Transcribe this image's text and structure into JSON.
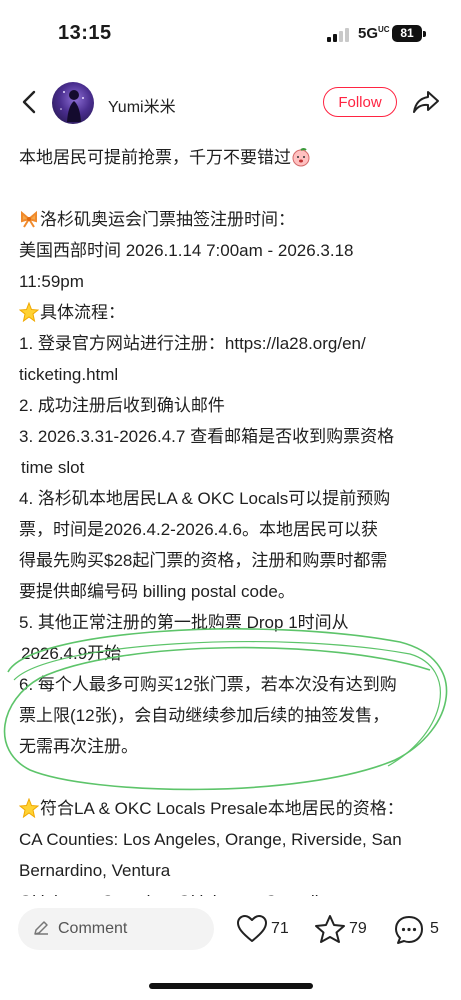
{
  "status_bar": {
    "time": "13:15",
    "network": "5G",
    "network_sup": "UC",
    "battery": "81"
  },
  "header": {
    "username": "Yumi米米",
    "follow_label": "Follow"
  },
  "post": {
    "intro": "本地居民可提前抢票，千万不要错过",
    "reg_title": "洛杉矶奥运会门票抽签注册时间：",
    "reg_time_1": "美国西部时间 2026.1.14 7:00am - 2026.3.18",
    "reg_time_2": "11:59pm",
    "process_title": "具体流程：",
    "step1a": "1. 登录官方网站进行注册：https://la28.org/en/",
    "step1b": "ticketing.html",
    "step2": "2. 成功注册后收到确认邮件",
    "step3a": "3. 2026.3.31-2026.4.7 查看邮箱是否收到购票资格",
    "step3b": "time slot",
    "step4a": "4. 洛杉矶本地居民LA & OKC Locals可以提前预购",
    "step4b": "票，时间是2026.4.2-2026.4.6。本地居民可以获",
    "step4c": "得最先购买$28起门票的资格，注册和购票时都需",
    "step4d": "要提供邮编号码 billing postal code。",
    "step5a": "5. 其他正常注册的第一批购票 Drop 1时间从",
    "step5b": "2026.4.9开始",
    "step6a": "6. 每个人最多可购买12张门票，若本次没有达到购",
    "step6b": "票上限(12张)，会自动继续参加后续的抽签发售，",
    "step6c": "无需再次注册。",
    "elig_title": "符合LA & OKC Locals Presale本地居民的资格：",
    "elig_ca1": "CA Counties: Los Angeles, Orange, Riverside, San",
    "elig_ca2": "Bernardino, Ventura",
    "elig_ok": "Oklahoma Counties: Oklahoma, Canadian,"
  },
  "bottom_bar": {
    "comment_placeholder": "Comment",
    "likes": "71",
    "stars": "79",
    "comments": "5"
  },
  "icons": {
    "back": "chevron-left-icon",
    "share": "share-arrow-icon",
    "intro_emoji": "peach-face-emoji",
    "reg_emoji": "ribbon-emoji",
    "sparkle_emoji": "glowing-star-emoji",
    "comment_edit": "pencil-icon",
    "like": "heart-icon",
    "star": "star-icon",
    "comment": "speech-bubble-icon"
  },
  "colors": {
    "accent": "#ff2442",
    "annotation": "#5dc46a"
  }
}
